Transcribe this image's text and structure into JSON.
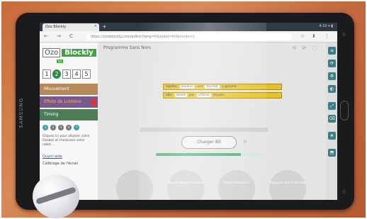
{
  "browser": {
    "tab_title": "Ozo Blockly",
    "tab_close": "✕",
    "new_tab": "+",
    "status": "4:10 ▾ ▮",
    "url": "https://ozoblockly.com/editor?lang=fr&robot=bit&mode=2",
    "nav": {
      "back": "←",
      "forward": "→",
      "reload": "C"
    },
    "menu": {
      "star": "☆",
      "download": "⬇",
      "more": "⋮"
    }
  },
  "tablet": {
    "brand": "SAMSUNG"
  },
  "left_panel": {
    "logo_ozo": "Ozo",
    "logo_blockly": "Blockly",
    "sublogo": "bit",
    "levels": [
      "1",
      "2",
      "3",
      "4",
      "5"
    ],
    "active_level": "2",
    "categories": [
      {
        "label": "Mouvement"
      },
      {
        "label": "Effets de Lumière"
      },
      {
        "label": "Timing"
      }
    ],
    "steps": [
      "1",
      "2",
      "3",
      "4",
      "?"
    ],
    "help_text": "Cliquez ici pour allumer votre Ozobot et choisissez votre robot…",
    "help_link": "Ouvrir aide",
    "calibrate_label": "Calibrage de l'écran"
  },
  "workspace": {
    "title": "Programme Sans Nom",
    "icons": "⟲ ⟳ ⬚",
    "block1": {
      "a": "répéter",
      "b": "couleur",
      "c": "vert",
      "d": "tourner",
      "e": "à gauche"
    },
    "block2": {
      "a": "aller",
      "b": "avant",
      "c": "pas",
      "d": "vitesse",
      "e": "moyen"
    },
    "run_button": "Charger Bit",
    "run_arrow": "▷",
    "progress": 0.8,
    "circles": [
      {
        "label": ""
      },
      {
        "label": "Ne pas bouger Ozobot"
      },
      {
        "label": "Placez Ozobot ici"
      },
      {
        "label": "Appuyez sur le bouton"
      }
    ]
  },
  "right_toolbar": {
    "buttons": [
      "≡",
      "⟳",
      "⚙",
      "◐",
      "⤢",
      "⌫",
      "★",
      "⬒"
    ]
  },
  "collapse_glyph": "‹"
}
